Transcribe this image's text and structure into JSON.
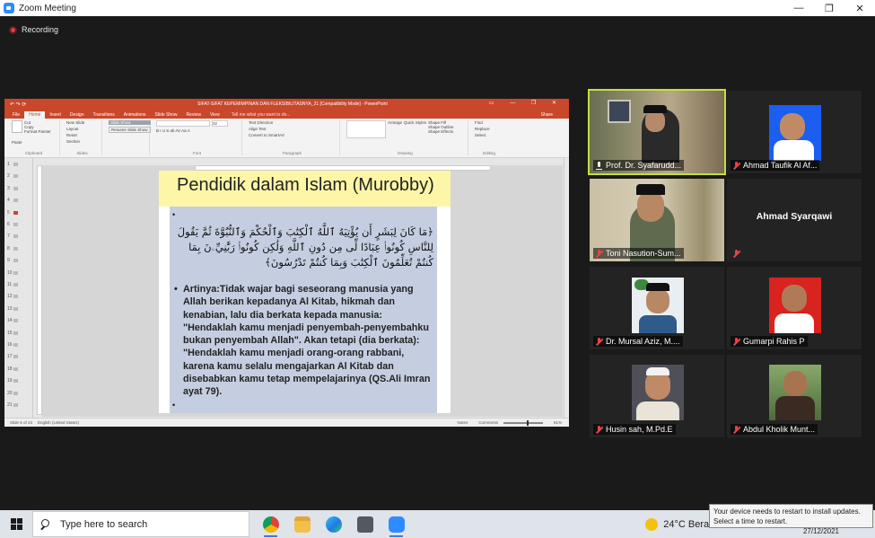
{
  "zoom": {
    "title": "Zoom Meeting",
    "minimize": "—",
    "restore": "❐",
    "close": "✕",
    "recording_label": "Recording"
  },
  "powerpoint": {
    "window_title": "SIFAT-SIFAT KEPEMIMPINAN DAN FLEKSIBILITASNYA_21 [Compatibility Mode] - PowerPoint",
    "qat": "↶ ↷ ⟳",
    "winbtns": "▭ — ❐ ✕",
    "tabs": [
      "File",
      "Home",
      "Insert",
      "Design",
      "Transitions",
      "Animations",
      "Slide Show",
      "Review",
      "View"
    ],
    "active_tab": "Home",
    "tell_me": "Tell me what you want to do...",
    "share": "Share",
    "ribbon": {
      "clipboard": {
        "label": "Clipboard",
        "items": [
          "Paste",
          "Cut",
          "Copy",
          "Format Painter"
        ]
      },
      "slides": {
        "label": "Slides",
        "items": [
          "New Slide",
          "Layout",
          "Reset",
          "Section"
        ]
      },
      "slideshow_buttons": [
        "Slide Show",
        "Resume Slide Show"
      ],
      "font": {
        "label": "Font",
        "size": "32"
      },
      "paragraph": {
        "label": "Paragraph",
        "items": [
          "Text Direction",
          "Align Text",
          "Convert to SmartArt"
        ]
      },
      "drawing": {
        "label": "Drawing",
        "items": [
          "Arrange",
          "Quick Styles",
          "Shape Fill",
          "Shape Outline",
          "Shape Effects"
        ]
      },
      "editing": {
        "label": "Editing",
        "items": [
          "Find",
          "Replace",
          "Select"
        ]
      }
    },
    "thumbnail_numbers": [
      "1",
      "2",
      "3",
      "4",
      "5",
      "6",
      "7",
      "8",
      "9",
      "10",
      "11",
      "12",
      "13",
      "14",
      "15",
      "16",
      "17",
      "18",
      "19",
      "20",
      "21"
    ],
    "selected_slide": "5",
    "slide": {
      "title": "Pendidik dalam Islam (Murobby)",
      "bullet_marks": [
        "•",
        "•",
        "•"
      ],
      "arabic_text": "﴿مَا كَانَ لِبَشَرٍ أَن يُؤْتِيَهُ ٱللَّهُ ٱلْكِتَٰبَ وَٱلْحُكْمَ وَٱلنُّبُوَّةَ ثُمَّ يَقُولَ لِلنَّاسِ كُونُوا۟ عِبَادًا لِّى مِن دُونِ ٱللَّهِ وَلَٰكِن كُونُوا۟ رَبَّٰنِيِّۦنَ بِمَا كُنتُمْ تُعَلِّمُونَ ٱلْكِتَٰبَ وَبِمَا كُنتُمْ تَدْرُسُونَ﴾",
      "body_text": "Artinya:Tidak wajar bagi seseorang manusia yang Allah berikan kepadanya Al Kitab, hikmah dan kenabian, lalu dia berkata kepada manusia: \"Hendaklah kamu menjadi penyembah-penyembahku bukan penyembah Allah\". Akan tetapi (dia berkata): \"Hendaklah kamu menjadi orang-orang rabbani, karena kamu selalu mengajarkan Al Kitab dan disebabkan kamu tetap mempelajarinya (QS.Ali Imran ayat 79)."
    },
    "status": {
      "slide_count": "Slide 5 of 43",
      "language": "English (United States)",
      "notes": "Notes",
      "comments": "Comments",
      "zoom": "61%"
    }
  },
  "participants": [
    {
      "name": "Prof. Dr. Syafarudd...",
      "muted": false,
      "active_speaker": true,
      "has_video": true
    },
    {
      "name": "Ahmad Taufik Al Af...",
      "muted": true,
      "has_video": true
    },
    {
      "name": "Toni Nasution-Sum...",
      "muted": true,
      "has_video": true
    },
    {
      "name": "Ahmad Syarqawi",
      "muted": true,
      "has_video": false
    },
    {
      "name": "Dr. Mursal Aziz, M....",
      "muted": true,
      "has_video": true
    },
    {
      "name": "Gumarpi Rahis P",
      "muted": true,
      "has_video": true
    },
    {
      "name": "Husin sah, M.Pd.E",
      "muted": true,
      "has_video": true
    },
    {
      "name": "Abdul Kholik Munt...",
      "muted": true,
      "has_video": true
    }
  ],
  "taskbar": {
    "search_placeholder": "Type here to search",
    "apps": [
      "chrome-icon",
      "file-explorer-icon",
      "edge-icon",
      "camera-icon",
      "zoom-icon"
    ],
    "weather": "24°C  Berawan",
    "chevron": "^",
    "date": "27/12/2021"
  },
  "toast": {
    "line1": "Your device needs to restart to install updates.",
    "line2": "Select a time to restart."
  },
  "colors": {
    "ppt_accent": "#c9472b",
    "active_speaker": "#c4e03a",
    "muted_red": "#e84545",
    "slide_title_band": "#fdf6a7",
    "content_box": "#c5cee1"
  }
}
